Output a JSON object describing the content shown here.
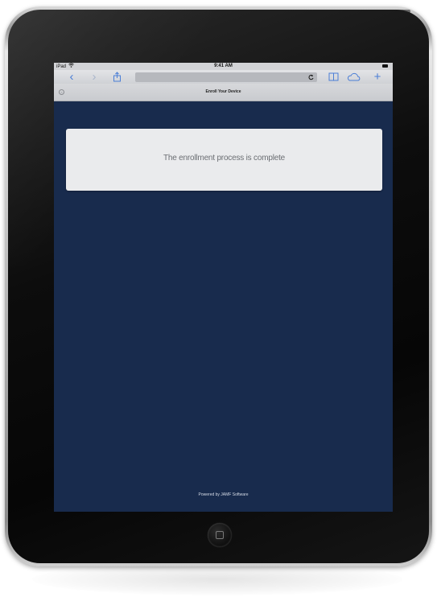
{
  "status_bar": {
    "carrier": "iPad",
    "time": "9:41 AM"
  },
  "toolbar": {
    "back_glyph": "‹",
    "forward_glyph": "›",
    "plus_glyph": "+"
  },
  "page": {
    "title": "Enroll Your Device",
    "message": "The enrollment process is complete",
    "footer": "Powered by JAMF Software"
  },
  "colors": {
    "screen_background": "#182b4d",
    "toolbar_accent": "#4b7ed6"
  }
}
